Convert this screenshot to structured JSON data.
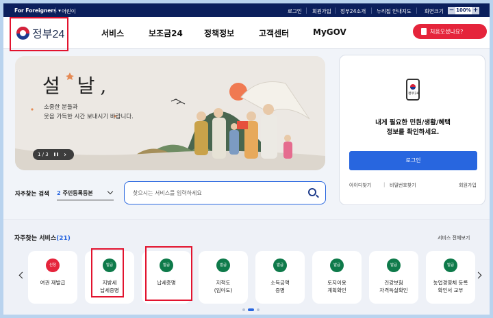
{
  "utilbar": {
    "foreigners": "For Foreigners ▾",
    "kids": "어린이",
    "links": [
      "로그인",
      "회원가입",
      "정부24소개",
      "누리집 안내지도"
    ],
    "zoom_label": "화면크기",
    "zoom_minus": "−",
    "zoom_value": "100%",
    "zoom_plus": "+"
  },
  "header": {
    "logo_text": "정부24",
    "nav": [
      "서비스",
      "보조금24",
      "정책정보",
      "고객센터",
      "MyGOV"
    ],
    "cta": "처음오셨나요?"
  },
  "banner": {
    "title": "설 날,",
    "subtitle_line1": "소중한 분들과",
    "subtitle_line2": "웃음 가득한 시간 보내시기 바랍니다.",
    "pager": "1 / 3",
    "pause": "❚❚",
    "next": "›"
  },
  "login_card": {
    "phone_logo": "정부24",
    "message_line1": "내게 필요한 민원/생활/혜택",
    "message_line2": "정보를 확인하세요.",
    "login_button": "로그인",
    "find_id": "아이디찾기",
    "find_pw": "비밀번호찾기",
    "signup": "회원가입"
  },
  "search": {
    "label": "자주찾는 검색",
    "select_num": "2",
    "select_value": "주민등록등본",
    "placeholder": "찾으시는 서비스를 입력하세요"
  },
  "services": {
    "title": "자주찾는 서비스",
    "count": "(21)",
    "view_all": "서비스 전체보기",
    "colors": {
      "apply": "#e5243b",
      "issue": "#0e7a4a"
    },
    "items": [
      {
        "badge": "신청",
        "line1": "여권 재발급",
        "line2": "",
        "type": "apply"
      },
      {
        "badge": "발급",
        "line1": "지방세",
        "line2": "납세증명",
        "type": "issue"
      },
      {
        "badge": "발급",
        "line1": "납세증명",
        "line2": "",
        "type": "issue"
      },
      {
        "badge": "발급",
        "line1": "지적도",
        "line2": "(임야도)",
        "type": "issue"
      },
      {
        "badge": "발급",
        "line1": "소득금액",
        "line2": "증명",
        "type": "issue"
      },
      {
        "badge": "발급",
        "line1": "토지이용",
        "line2": "계획확인",
        "type": "issue"
      },
      {
        "badge": "발급",
        "line1": "건강보험",
        "line2": "자격득실확인",
        "type": "issue"
      },
      {
        "badge": "발급",
        "line1": "농업경영체 등록",
        "line2": "확인서 교부",
        "type": "issue"
      }
    ]
  }
}
